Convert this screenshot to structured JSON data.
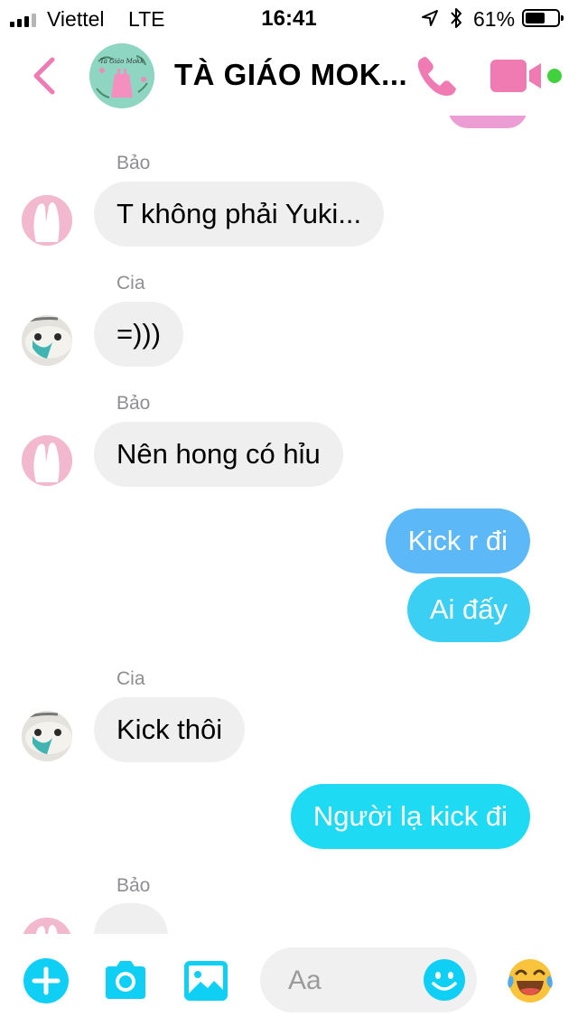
{
  "status_bar": {
    "carrier": "Viettel",
    "network": "LTE",
    "time": "16:41",
    "battery_percent": "61%",
    "battery_level": 0.61,
    "signal_bars_filled": 3,
    "icons": [
      "signal-bars-icon",
      "location-arrow-icon",
      "bluetooth-icon",
      "battery-icon"
    ]
  },
  "header": {
    "title": "TÀ GIÁO MOK...",
    "avatar_text": "Tà Giáo Mokk",
    "icons": [
      "back-chevron-icon",
      "phone-icon",
      "video-camera-icon"
    ],
    "online_status_color": "#40d13d",
    "accent_color": "#f07ab2"
  },
  "messages": [
    {
      "sender": "Bảo",
      "direction": "incoming",
      "text": "T không phải Yuki..."
    },
    {
      "sender": "Cia",
      "direction": "incoming",
      "text": "=)))"
    },
    {
      "sender": "Bảo",
      "direction": "incoming",
      "text": "Nên hong có hỉu"
    },
    {
      "direction": "outgoing",
      "text": "Kick r đi",
      "color": "#5cb8f7"
    },
    {
      "direction": "outgoing",
      "text": "Ai đấy",
      "color": "#3ccff4"
    },
    {
      "sender": "Cia",
      "direction": "incoming",
      "text": "Kick thôi"
    },
    {
      "direction": "outgoing",
      "text": "Người lạ kick đi",
      "color": "#1fdaf3"
    },
    {
      "sender": "Bảo",
      "direction": "incoming",
      "text": ""
    }
  ],
  "composer": {
    "placeholder": "Aa",
    "icons": [
      "plus-icon",
      "camera-icon",
      "image-icon",
      "smiley-icon",
      "laughing-emoji-icon"
    ],
    "button_color": "#0fcff5"
  }
}
